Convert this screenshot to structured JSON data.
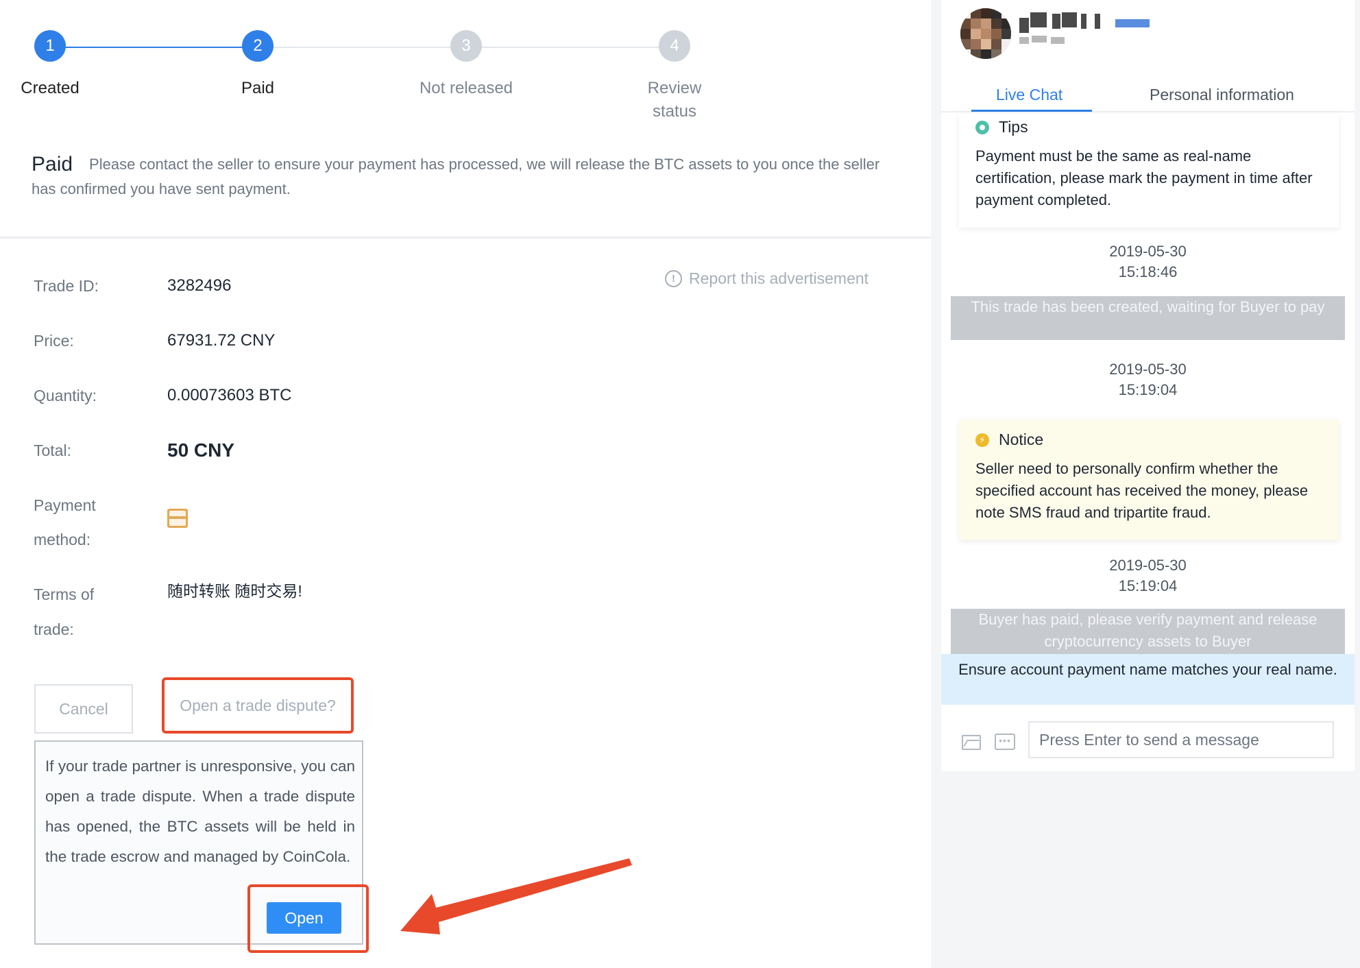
{
  "steps": [
    {
      "number": "1",
      "label": "Created",
      "state": "done"
    },
    {
      "number": "2",
      "label": "Paid",
      "state": "done"
    },
    {
      "number": "3",
      "label": "Not released",
      "state": "pending"
    },
    {
      "number": "4",
      "label": "Review status",
      "state": "pending"
    }
  ],
  "status": {
    "title": "Paid",
    "message": "Please contact the seller to ensure your payment has processed, we will release the BTC assets to you once the seller has confirmed you have sent payment."
  },
  "report_link": "Report this advertisement",
  "trade": {
    "trade_id_label": "Trade ID:",
    "trade_id": "3282496",
    "price_label": "Price:",
    "price": "67931.72 CNY",
    "quantity_label": "Quantity:",
    "quantity": "0.00073603 BTC",
    "total_label": "Total:",
    "total": "50 CNY",
    "payment_label_1": "Payment",
    "payment_label_2": "method:",
    "payment_icon": "bank-card-icon",
    "terms_label_1": "Terms of",
    "terms_label_2": "trade:",
    "terms": "随时转账 随时交易!"
  },
  "actions": {
    "cancel": "Cancel",
    "dispute": "Open a trade dispute?"
  },
  "dispute_popover": {
    "text": "If your trade partner is unresponsive, you can open a trade dispute. When a trade dispute has opened, the BTC assets will be held in the trade escrow and managed by CoinCola.",
    "open_button": "Open"
  },
  "chat": {
    "tabs": [
      "Live Chat",
      "Personal information"
    ],
    "active_tab": "Live Chat",
    "tips": {
      "title": "Tips",
      "text": "Payment must be the same as real-name certification, please mark the payment in time after payment completed."
    },
    "messages": [
      {
        "date": "2019-05-30",
        "time": "15:18:46",
        "system": "This trade has been created, waiting for Buyer to pay"
      },
      {
        "date": "2019-05-30",
        "time": "15:19:04"
      },
      {
        "date": "2019-05-30",
        "time": "15:19:04",
        "system": "Buyer has paid, please verify payment and release cryptocurrency assets to Buyer"
      }
    ],
    "notice": {
      "title": "Notice",
      "text": "Seller need to personally confirm whether the specified account has received the money, please note SMS fraud and tripartite fraud."
    },
    "ensure_banner": "Ensure account payment name matches your real name.",
    "input_placeholder": "Press Enter to send a message"
  },
  "colors": {
    "accent": "#2f7fe8",
    "highlight": "#e8492a",
    "tips_icon": "#4fbfa8",
    "notice_icon": "#f0b92a",
    "notice_bg": "#fdfbea"
  }
}
